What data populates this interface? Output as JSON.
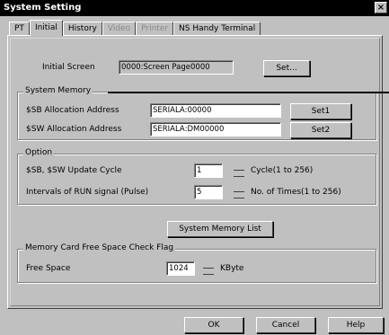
{
  "window": {
    "title": "System Setting",
    "close_label": "×"
  },
  "tabs": [
    {
      "label": "PT",
      "state": "normal"
    },
    {
      "label": "Initial",
      "state": "active"
    },
    {
      "label": "History",
      "state": "normal"
    },
    {
      "label": "Video",
      "state": "disabled"
    },
    {
      "label": "Printer",
      "state": "disabled"
    },
    {
      "label": "NS Handy Terminal",
      "state": "normal"
    }
  ],
  "initial_screen": {
    "label": "Initial Screen",
    "value": "0000:Screen Page0000",
    "set_label": "Set..."
  },
  "system_memory": {
    "title": "System Memory",
    "sb_label": "$SB Allocation Address",
    "sb_value": "SERIALA:00000",
    "sb_set_label": "Set1",
    "sw_label": "$SW Allocation Address",
    "sw_value": "SERIALA:DM00000",
    "sw_set_label": "Set2"
  },
  "option": {
    "title": "Option",
    "cycle_label": "$SB, $SW Update Cycle",
    "cycle_value": "1",
    "cycle_unit": "Cycle(1 to 256)",
    "intervals_label": "Intervals of RUN signal (Pulse)",
    "intervals_value": "5",
    "intervals_unit": "No. of Times(1 to 256)"
  },
  "system_memory_list_label": "System Memory List",
  "memory_card": {
    "title": "Memory Card Free Space Check Flag",
    "free_label": "Free Space",
    "free_value": "1024",
    "free_unit": "KByte"
  },
  "footer": {
    "ok_label": "OK",
    "cancel_label": "Cancel",
    "help_label": "Help"
  }
}
